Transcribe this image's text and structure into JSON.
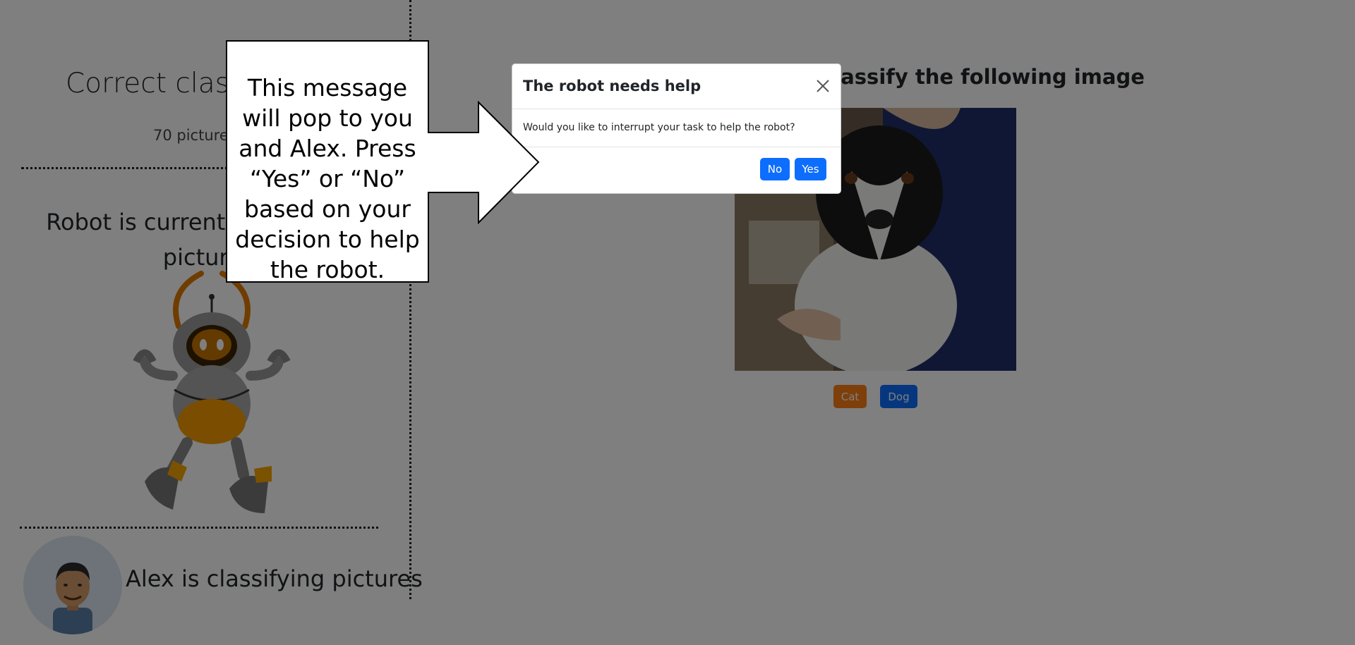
{
  "left": {
    "score_title": "Correct classifications",
    "score_sub": "70 pictures left",
    "robot_status": "Robot is currently classifying pictures",
    "alex_status": "Alex is classifying pictures"
  },
  "task": {
    "title": "Classify the following image",
    "cat_label": "Cat",
    "dog_label": "Dog"
  },
  "modal": {
    "title": "The robot needs help",
    "body": "Would you like to interrupt your task to help the robot?",
    "no_label": "No",
    "yes_label": "Yes"
  },
  "callout": {
    "text": "This message will pop to you and Alex. Press “Yes” or “No” based on your decision to help the robot."
  },
  "colors": {
    "primary": "#0d6efd",
    "cat": "#fd7e14",
    "robot_orange": "#e07b00"
  },
  "icons": [
    "close-icon",
    "robot-icon",
    "avatar-icon",
    "arrow-icon"
  ]
}
